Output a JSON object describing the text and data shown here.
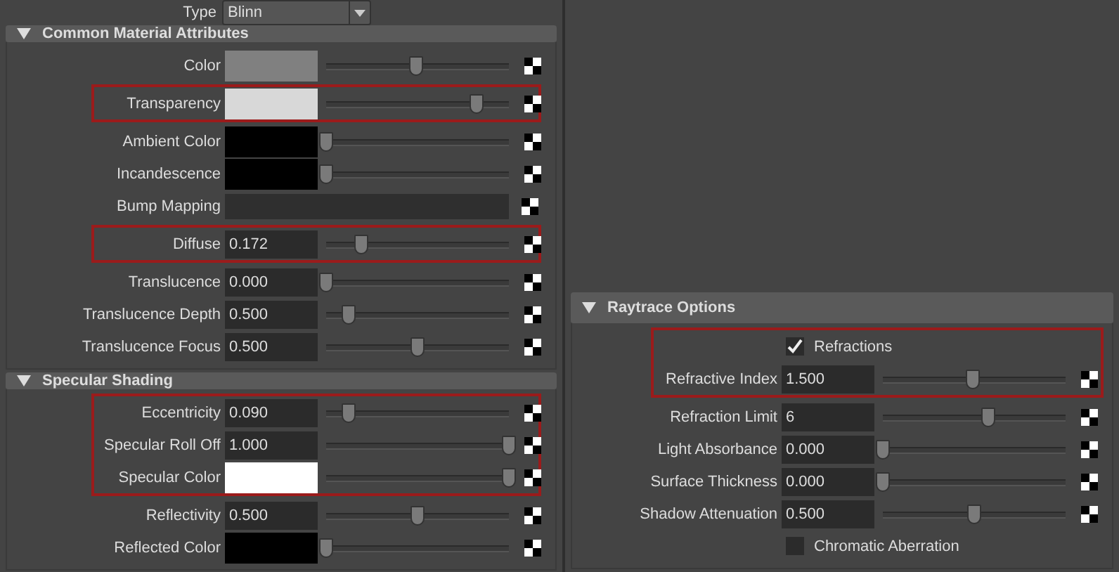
{
  "type_field": {
    "label": "Type",
    "value": "Blinn"
  },
  "left_sections": [
    {
      "title": "Common Material Attributes",
      "expanded": true,
      "rows": [
        {
          "kind": "color",
          "label": "Color",
          "color": "#808080",
          "level": 0.49,
          "highlighted": false
        },
        {
          "kind": "color",
          "label": "Transparency",
          "color": "#d8d8d8",
          "level": 0.82,
          "highlighted": true
        },
        {
          "kind": "color",
          "label": "Ambient Color",
          "color": "#000000",
          "level": 0,
          "highlighted": false
        },
        {
          "kind": "color",
          "label": "Incandescence",
          "color": "#000000",
          "level": 0,
          "highlighted": false
        },
        {
          "kind": "map",
          "label": "Bump Mapping",
          "highlighted": false
        },
        {
          "kind": "number",
          "label": "Diffuse",
          "value": "0.172",
          "level": 0.19,
          "highlighted": true
        },
        {
          "kind": "number",
          "label": "Translucence",
          "value": "0.000",
          "level": 0,
          "highlighted": false
        },
        {
          "kind": "number",
          "label": "Translucence Depth",
          "value": "0.500",
          "level": 0.12,
          "highlighted": false
        },
        {
          "kind": "number",
          "label": "Translucence Focus",
          "value": "0.500",
          "level": 0.5,
          "highlighted": false
        }
      ]
    },
    {
      "title": "Specular Shading",
      "expanded": true,
      "rows": [
        {
          "kind": "number",
          "label": "Eccentricity",
          "value": "0.090",
          "level": 0.12,
          "highlighted": true
        },
        {
          "kind": "number",
          "label": "Specular Roll Off",
          "value": "1.000",
          "level": 1,
          "highlighted": true
        },
        {
          "kind": "color",
          "label": "Specular Color",
          "color": "#ffffff",
          "level": 1,
          "highlighted": true
        },
        {
          "kind": "number",
          "label": "Reflectivity",
          "value": "0.500",
          "level": 0.5,
          "highlighted": false
        },
        {
          "kind": "color",
          "label": "Reflected Color",
          "color": "#000000",
          "level": 0,
          "highlighted": false
        }
      ]
    }
  ],
  "right_sections": [
    {
      "title": "Raytrace Options",
      "expanded": true,
      "rows": [
        {
          "kind": "checkbox",
          "label": "Refractions",
          "checked": true,
          "highlighted": true
        },
        {
          "kind": "number",
          "label": "Refractive Index",
          "value": "1.500",
          "level": 0.49,
          "highlighted": true
        },
        {
          "kind": "number",
          "label": "Refraction Limit",
          "value": "6",
          "level": 0.58,
          "highlighted": false
        },
        {
          "kind": "number",
          "label": "Light Absorbance",
          "value": "0.000",
          "level": 0,
          "highlighted": false
        },
        {
          "kind": "number",
          "label": "Surface Thickness",
          "value": "0.000",
          "level": 0,
          "highlighted": false
        },
        {
          "kind": "number",
          "label": "Shadow Attenuation",
          "value": "0.500",
          "level": 0.5,
          "highlighted": false
        },
        {
          "kind": "checkbox",
          "label": "Chromatic Aberration",
          "checked": false,
          "highlighted": false
        }
      ]
    }
  ]
}
